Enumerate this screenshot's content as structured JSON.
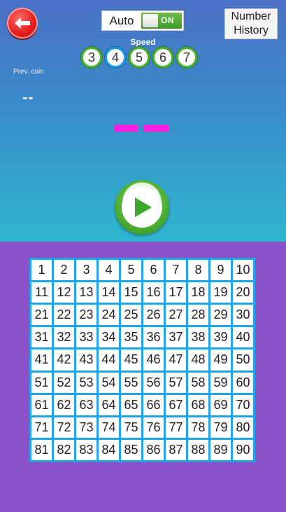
{
  "auto": {
    "label": "Auto",
    "toggle_text": "ON"
  },
  "history": {
    "line1": "Number",
    "line2": "History"
  },
  "speed": {
    "label": "Speed",
    "options": [
      "3",
      "4",
      "5",
      "6",
      "7"
    ],
    "selected": "4"
  },
  "prev_coin": {
    "label": "Prev. coin",
    "value": "--"
  },
  "board": {
    "numbers": [
      "1",
      "2",
      "3",
      "4",
      "5",
      "6",
      "7",
      "8",
      "9",
      "10",
      "11",
      "12",
      "13",
      "14",
      "15",
      "16",
      "17",
      "18",
      "19",
      "20",
      "21",
      "22",
      "23",
      "24",
      "25",
      "26",
      "27",
      "28",
      "29",
      "30",
      "31",
      "32",
      "33",
      "34",
      "35",
      "36",
      "37",
      "38",
      "39",
      "40",
      "41",
      "42",
      "43",
      "44",
      "45",
      "46",
      "47",
      "48",
      "49",
      "50",
      "51",
      "52",
      "53",
      "54",
      "55",
      "56",
      "57",
      "58",
      "59",
      "60",
      "61",
      "62",
      "63",
      "64",
      "65",
      "66",
      "67",
      "68",
      "69",
      "70",
      "71",
      "72",
      "73",
      "74",
      "75",
      "76",
      "77",
      "78",
      "79",
      "80",
      "81",
      "82",
      "83",
      "84",
      "85",
      "86",
      "87",
      "88",
      "89",
      "90"
    ]
  },
  "colors": {
    "accent_green": "#49b339",
    "back_red": "#e41e1e",
    "dash_magenta": "#ff1fe0",
    "board_blue": "#1fa6e6",
    "purple_bg": "#8a52c9"
  },
  "icons": {
    "back": "arrow-left-icon",
    "play": "play-icon"
  }
}
